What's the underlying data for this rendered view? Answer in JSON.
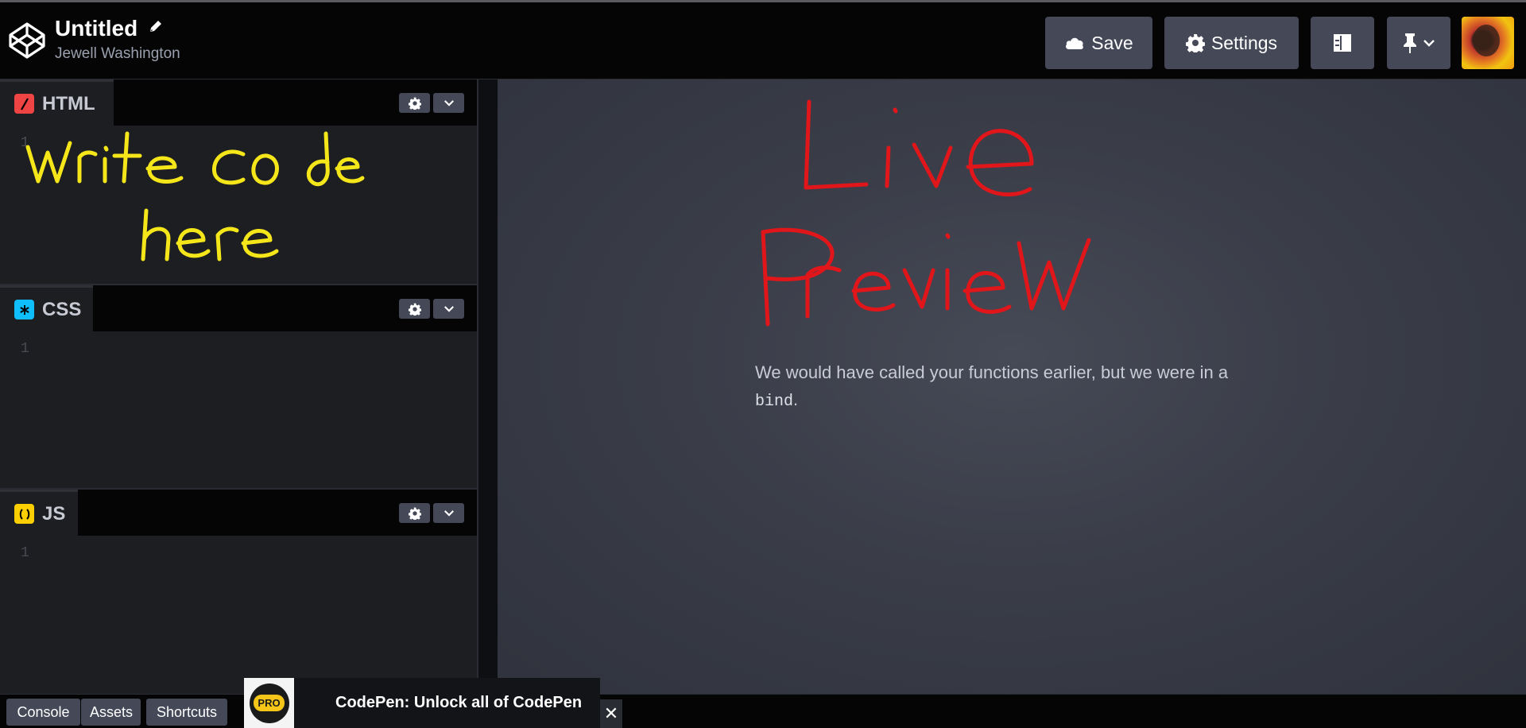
{
  "header": {
    "title": "Untitled",
    "author": "Jewell Washington",
    "buttons": {
      "save": "Save",
      "settings": "Settings"
    }
  },
  "editors": [
    {
      "name": "HTML",
      "badge_color": "#ef4444",
      "badge_glyph": "/",
      "line": "1"
    },
    {
      "name": "CSS",
      "badge_color": "#0ebeff",
      "badge_glyph": "*",
      "line": "1"
    },
    {
      "name": "JS",
      "badge_color": "#fcd000",
      "badge_glyph": "( )",
      "line": "1"
    }
  ],
  "preview": {
    "message_before": "We would have called your functions earlier, but we were in a",
    "message_code": "bind",
    "message_after": "."
  },
  "annotations": {
    "editor_note": "Write code here",
    "preview_note": "Live Preview",
    "editor_note_color": "#f5e61a",
    "preview_note_color": "#e0161b"
  },
  "footer": {
    "console": "Console",
    "assets": "Assets",
    "shortcuts": "Shortcuts",
    "promo_badge": "PRO",
    "promo_text": "CodePen: Unlock all of CodePen",
    "close": "✕"
  },
  "icons": [
    "codepen-logo-icon",
    "pencil-icon",
    "cloud-icon",
    "gear-icon",
    "layout-icon",
    "pin-icon",
    "chevron-down-icon",
    "close-icon"
  ]
}
